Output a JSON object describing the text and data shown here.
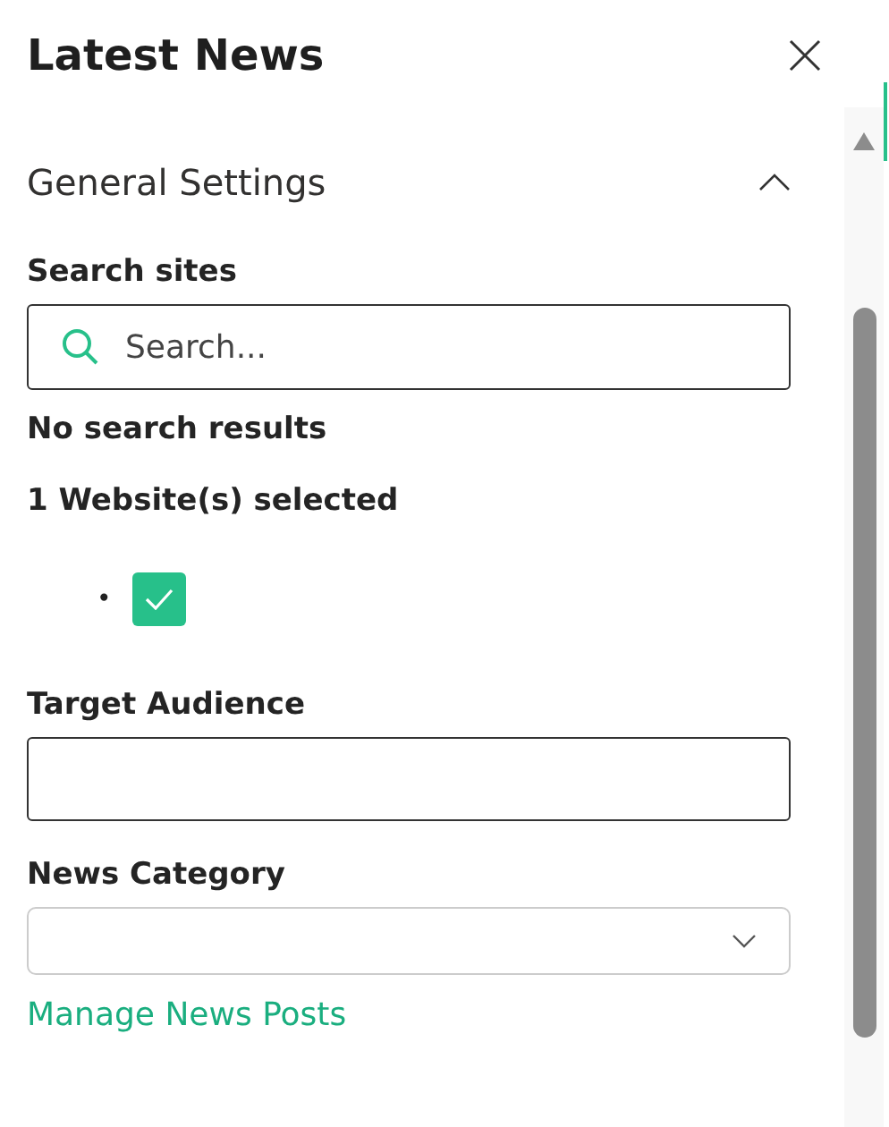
{
  "panel": {
    "title": "Latest News"
  },
  "section": {
    "title": "General Settings",
    "expanded": true
  },
  "search": {
    "label": "Search sites",
    "placeholder": "Search..."
  },
  "search_status": "No search results",
  "selected_count": "1 Website(s) selected",
  "websites": [
    {
      "marker": "•",
      "checked": true
    }
  ],
  "target_audience": {
    "label": "Target Audience"
  },
  "news_category": {
    "label": "News Category"
  },
  "link": "Manage News Posts"
}
